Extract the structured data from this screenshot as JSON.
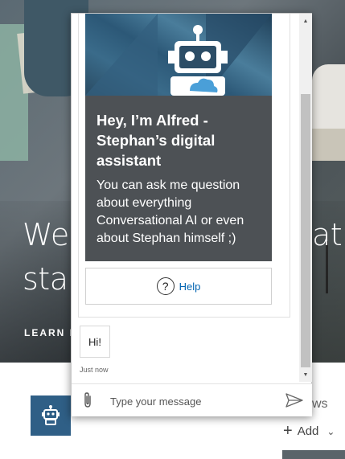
{
  "background": {
    "hero": {
      "line1_left": "We",
      "line1_right": "at",
      "line2_left": "star",
      "learn_link": "LEARN M"
    },
    "below": {
      "ws_text": "ws",
      "add_label": "Add"
    }
  },
  "chat": {
    "card": {
      "title": "Hey, I’m Alfred - Stephan’s digital assistant",
      "text": "You can ask me question about everything Conversational AI or even about Stephan himself ;)",
      "help_label": "Help",
      "help_icon_glyph": "?"
    },
    "messages": [
      {
        "from": "user",
        "text": "Hi!"
      }
    ],
    "timestamp": "Just now",
    "input": {
      "placeholder": "Type your message"
    }
  },
  "colors": {
    "card_body": "#4d5155",
    "link": "#0063b1",
    "avatar_tile": "#2f5f86"
  },
  "icons": {
    "robot": "robot-icon",
    "help": "help-circle-icon",
    "attach": "paperclip-icon",
    "send": "send-icon",
    "add": "plus-icon",
    "chevron": "chevron-down-icon"
  }
}
